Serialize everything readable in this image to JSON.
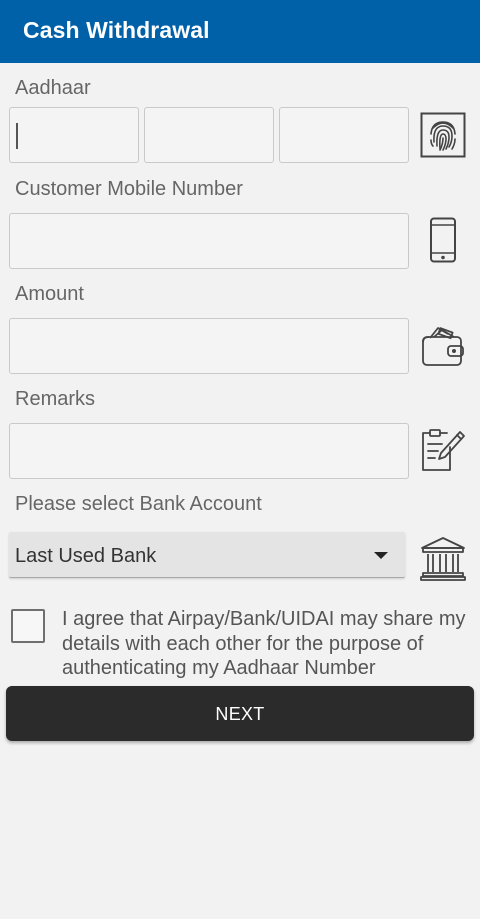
{
  "header": {
    "title": "Cash Withdrawal"
  },
  "form": {
    "aadhaar": {
      "label": "Aadhaar",
      "parts": [
        "",
        "",
        ""
      ],
      "icon": "fingerprint-icon"
    },
    "mobile": {
      "label": "Customer Mobile Number",
      "value": "",
      "icon": "smartphone-icon"
    },
    "amount": {
      "label": "Amount",
      "value": "",
      "icon": "wallet-icon"
    },
    "remarks": {
      "label": "Remarks",
      "value": "",
      "icon": "edit-note-icon"
    },
    "bank": {
      "label": "Please select Bank Account",
      "selected": "Last Used Bank",
      "icon": "bank-icon"
    }
  },
  "consent": {
    "checked": false,
    "text": "I agree that Airpay/Bank/UIDAI may share my details with each other for the purpose of authenticating my Aadhaar Number"
  },
  "actions": {
    "next_label": "NEXT"
  },
  "colors": {
    "appbar": "#0060a8",
    "button": "#2b2b2b",
    "background": "#f2f2f2"
  }
}
